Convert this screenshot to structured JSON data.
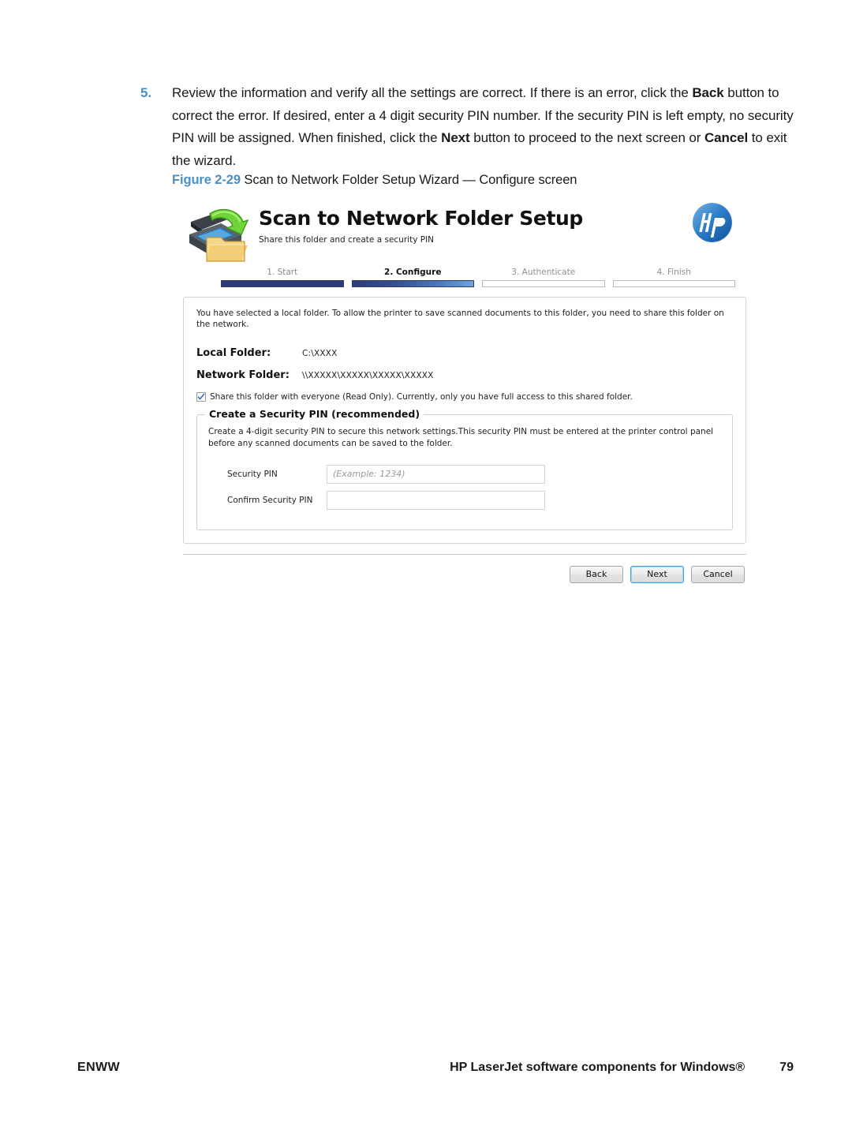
{
  "document": {
    "step": {
      "number": "5.",
      "text_parts": [
        {
          "t": "Review the information and verify all the settings are correct. If there is an error, click the ",
          "b": false
        },
        {
          "t": "Back",
          "b": true
        },
        {
          "t": " button to correct the error. If desired, enter a 4 digit security PIN number. If the security PIN is left empty, no security PIN will be assigned. When finished, click the ",
          "b": false
        },
        {
          "t": "Next",
          "b": true
        },
        {
          "t": " button to proceed to the next screen or ",
          "b": false
        },
        {
          "t": "Cancel",
          "b": true
        },
        {
          "t": " to exit the wizard.",
          "b": false
        }
      ]
    },
    "figure": {
      "label": "Figure 2-29",
      "caption": "Scan to Network Folder Setup Wizard — Configure screen"
    },
    "footer": {
      "left": "ENWW",
      "title": "HP LaserJet software components for Windows®",
      "page_number": "79"
    },
    "accent_color": "#4a90c8"
  },
  "wizard": {
    "icon_name": "scan-to-folder-icon",
    "logo_name": "hp-logo",
    "title": "Scan to Network Folder Setup",
    "subtitle": "Share this folder and create a security PIN",
    "steps": [
      {
        "label": "1. Start",
        "state": "done"
      },
      {
        "label": "2. Configure",
        "state": "current"
      },
      {
        "label": "3. Authenticate",
        "state": "todo"
      },
      {
        "label": "4. Finish",
        "state": "todo"
      }
    ],
    "intro": "You have selected a local folder. To allow the printer to save scanned documents to this folder, you need to share this folder on the network.",
    "folders": [
      {
        "label": "Local Folder:",
        "value": "C:\\XXXX"
      },
      {
        "label": "Network Folder:",
        "value": "\\\\XXXXX\\XXXXX\\XXXXX\\XXXXX"
      }
    ],
    "share_checkbox": {
      "checked": true,
      "label": "Share this folder with everyone (Read Only). Currently, only you have full access to this shared folder."
    },
    "pin_section": {
      "legend": "Create a Security PIN (recommended)",
      "description": "Create a 4-digit security PIN to secure this network settings.This security PIN must be entered at the printer control panel before any scanned documents can be saved to the folder.",
      "fields": [
        {
          "label": "Security PIN",
          "value": "",
          "placeholder": "(Example: 1234)"
        },
        {
          "label": "Confirm Security PIN",
          "value": "",
          "placeholder": ""
        }
      ]
    },
    "buttons": [
      {
        "label": "Back",
        "primary": false
      },
      {
        "label": "Next",
        "primary": true
      },
      {
        "label": "Cancel",
        "primary": false
      }
    ],
    "colors": {
      "step_done": "#2f3b78",
      "step_current_start": "#2f3b78",
      "step_current_end": "#6fa3de",
      "focus_ring": "#3fa0dd",
      "hp_blue": "#1e6fc4"
    }
  }
}
